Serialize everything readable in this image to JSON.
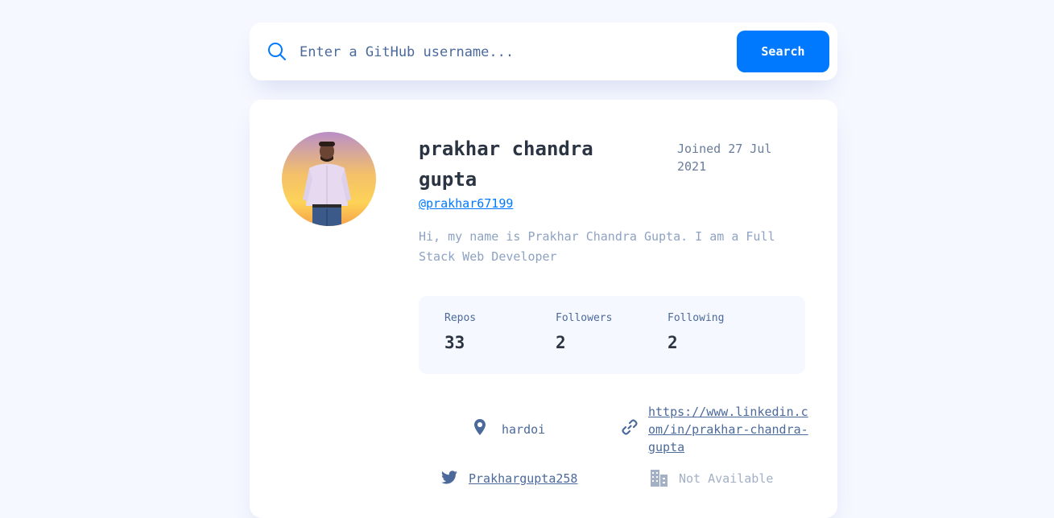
{
  "search": {
    "placeholder": "Enter a GitHub username...",
    "button_label": "Search"
  },
  "profile": {
    "name": "prakhar chandra gupta",
    "joined": "Joined 27 Jul 2021",
    "username": "@prakhar67199",
    "bio": "Hi, my name is Prakhar Chandra Gupta. I am a Full Stack Web Developer"
  },
  "stats": {
    "repos_label": "Repos",
    "repos_value": "33",
    "followers_label": "Followers",
    "followers_value": "2",
    "following_label": "Following",
    "following_value": "2"
  },
  "info": {
    "location": "hardoi",
    "blog": "https://www.linkedin.com/in/prakhar-chandra-gupta",
    "twitter": "Prakhargupta258",
    "company": "Not Available"
  },
  "colors": {
    "accent": "#0079ff",
    "background": "#f6f8ff",
    "text_dark": "#2b3442",
    "text_muted": "#4b6a9b"
  },
  "icons": {
    "search": "search-icon",
    "location": "location-pin-icon",
    "link": "link-icon",
    "twitter": "twitter-icon",
    "company": "building-icon"
  }
}
